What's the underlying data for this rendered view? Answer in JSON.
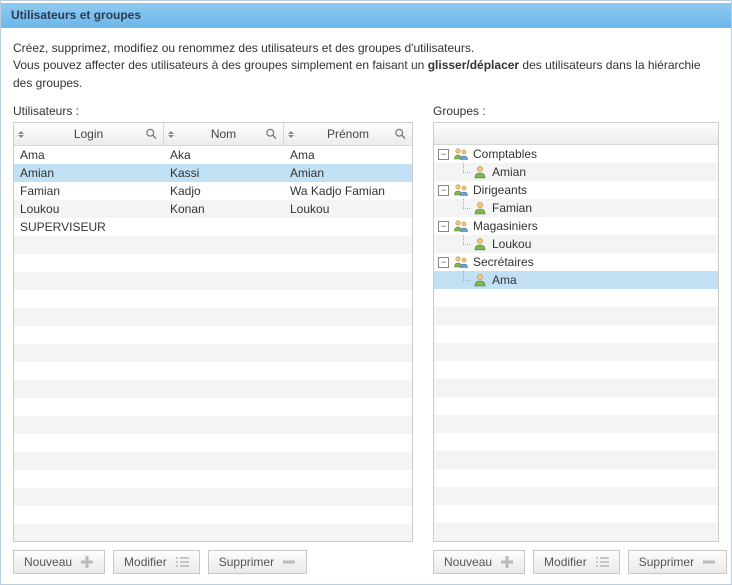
{
  "title": "Utilisateurs et groupes",
  "intro_line1": "Créez, supprimez, modifiez ou renommez des utilisateurs et des groupes d'utilisateurs.",
  "intro_line2a": "Vous pouvez affecter des utilisateurs à des groupes simplement en faisant un ",
  "intro_line2b_bold": "glisser/déplacer",
  "intro_line2c": " des utilisateurs dans la hiérarchie des groupes.",
  "users": {
    "heading": "Utilisateurs :",
    "columns": {
      "login": "Login",
      "nom": "Nom",
      "prenom": "Prénom"
    },
    "rows": [
      {
        "login": "Ama",
        "nom": "Aka",
        "prenom": "Ama",
        "selected": false
      },
      {
        "login": "Amian",
        "nom": "Kassi",
        "prenom": "Amian",
        "selected": true
      },
      {
        "login": "Famian",
        "nom": "Kadjo",
        "prenom": "Wa Kadjo Famian",
        "selected": false
      },
      {
        "login": "Loukou",
        "nom": "Konan",
        "prenom": "Loukou",
        "selected": false
      },
      {
        "login": "SUPERVISEUR",
        "nom": "",
        "prenom": "",
        "selected": false
      }
    ],
    "buttons": {
      "new": "Nouveau",
      "edit": "Modifier",
      "delete": "Supprimer"
    }
  },
  "groups": {
    "heading": "Groupes :",
    "tree": [
      {
        "type": "group",
        "label": "Comptables",
        "expanded": true
      },
      {
        "type": "user",
        "label": "Amian"
      },
      {
        "type": "group",
        "label": "Dirigeants",
        "expanded": true
      },
      {
        "type": "user",
        "label": "Famian"
      },
      {
        "type": "group",
        "label": "Magasiniers",
        "expanded": true
      },
      {
        "type": "user",
        "label": "Loukou"
      },
      {
        "type": "group",
        "label": "Secrétaires",
        "expanded": true
      },
      {
        "type": "user",
        "label": "Ama",
        "selected": true
      }
    ],
    "buttons": {
      "new": "Nouveau",
      "edit": "Modifier",
      "delete": "Supprimer"
    }
  }
}
